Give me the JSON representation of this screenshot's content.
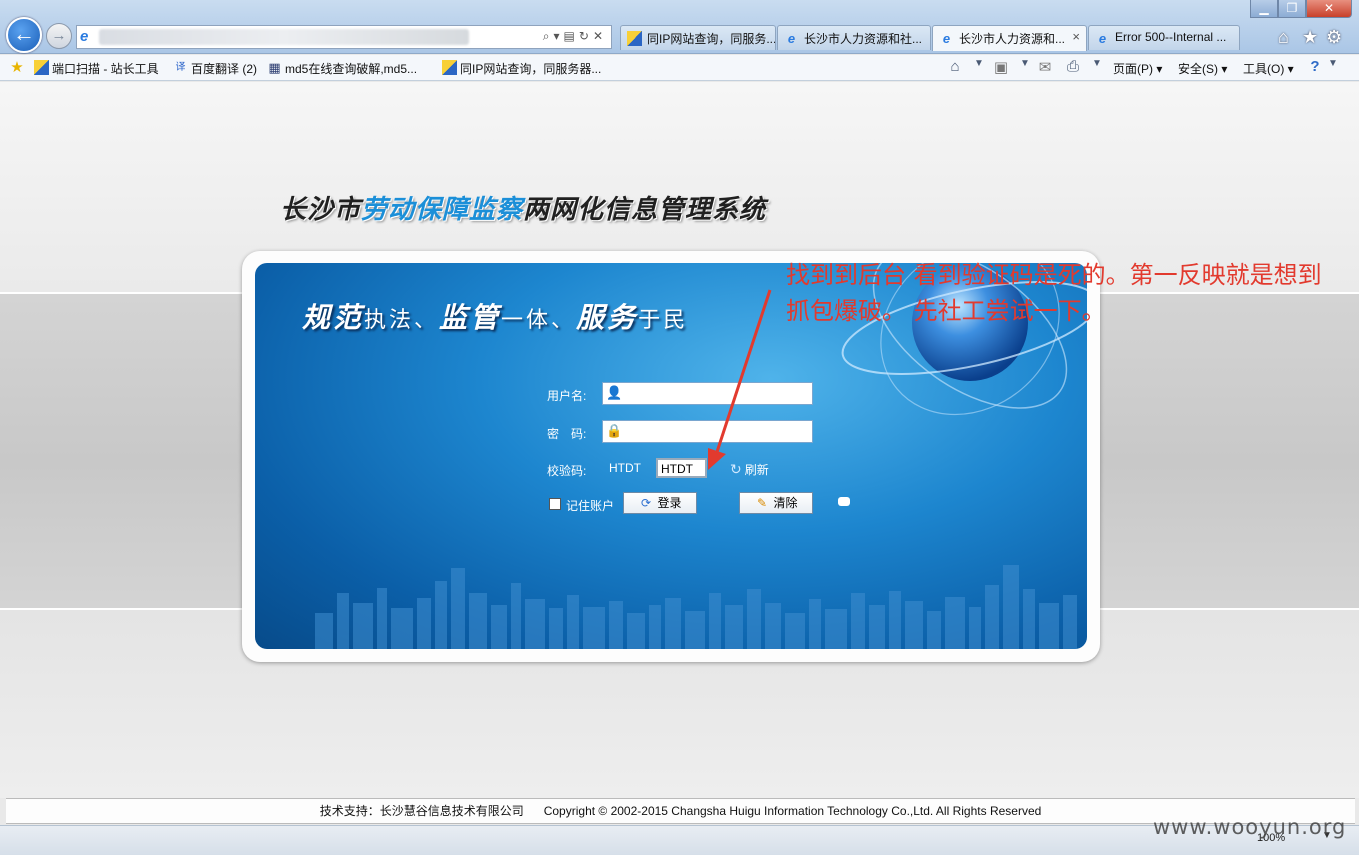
{
  "browser": {
    "tabs": [
      {
        "label": "同IP网站查询，同服务...",
        "icon": "site-icon"
      },
      {
        "label": "长沙市人力资源和社...",
        "icon": "ie-icon"
      },
      {
        "label": "长沙市人力资源和...",
        "icon": "ie-icon",
        "active": true
      },
      {
        "label": "Error 500--Internal ...",
        "icon": "ie-icon"
      }
    ],
    "tab_close": "×",
    "favorites": [
      {
        "label": "端口扫描 - 站长工具"
      },
      {
        "label": "百度翻译 (2)"
      },
      {
        "label": "md5在线查询破解,md5..."
      },
      {
        "label": "同IP网站查询，同服务器..."
      }
    ],
    "commands": {
      "page": "页面(P)",
      "safety": "安全(S)",
      "tools": "工具(O)"
    },
    "zoom": "100%"
  },
  "page": {
    "title_pre": "长沙市",
    "title_hl": "劳动保障监察",
    "title_post": "两网化信息管理系统",
    "slogan": {
      "w1": "规范",
      "t1": "执法、",
      "w2": "监管",
      "t2": "一体、",
      "w3": "服务",
      "t3": "于民"
    },
    "form": {
      "username_label": "用户名:",
      "password_label": "密　码:",
      "captcha_label": "校验码:",
      "captcha_code": "HTDT",
      "captcha_value": "HTDT",
      "refresh_label": "刷新",
      "remember_label": "记住账户",
      "login_label": "登录",
      "clear_label": "清除"
    },
    "annotation": "找到到后台 看到验证码是死的。第一反映就是想到抓包爆破。 先社工尝试一下。"
  },
  "footer": {
    "support": "技术支持：长沙慧谷信息技术有限公司",
    "copyright": "Copyright © 2002-2015 Changsha Huigu Information Technology Co.,Ltd. All Rights Reserved"
  },
  "watermark": "www.wooyun.org",
  "colors": {
    "annotation": "#e23a2e",
    "title_highlight": "#1b8fd8",
    "panel_blue": "#1d86cf"
  }
}
